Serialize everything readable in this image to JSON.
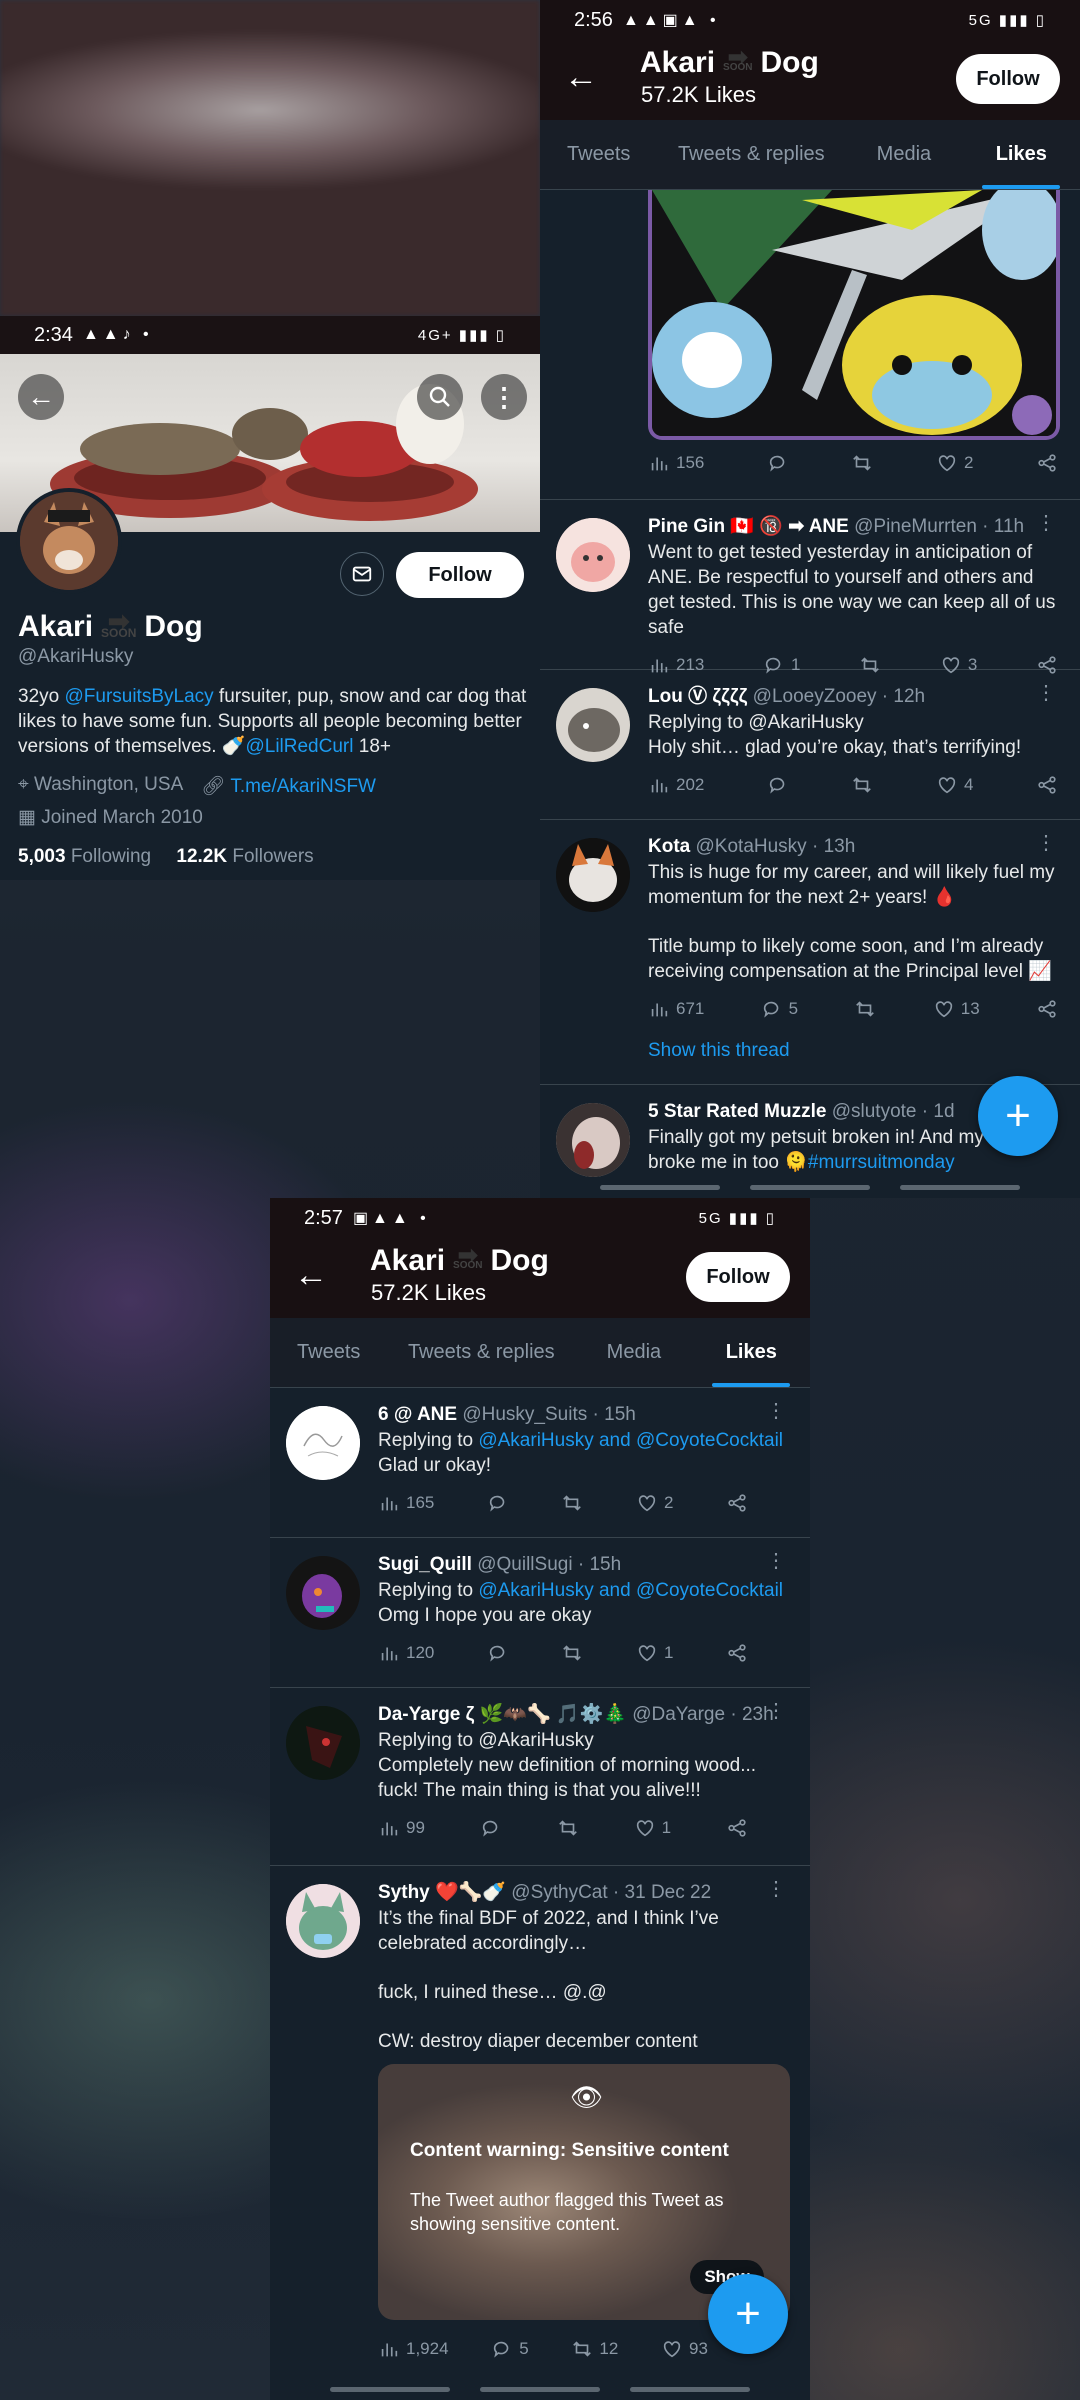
{
  "profile_panel": {
    "status": {
      "time": "2:34",
      "net": "4G+"
    },
    "name_a": "Akari",
    "name_b": "Dog",
    "arrow_text": "SOON",
    "handle": "@AkariHusky",
    "bio_1": "32yo ",
    "bio_link1": "@FursuitsByLacy",
    "bio_2": " fursuiter, pup, snow and car dog that likes to have some fun. Supports all people becoming better versions of themselves. 🍼",
    "bio_link2": "@LilRedCurl",
    "bio_3": " 18+",
    "location": "Washington, USA",
    "link": "T.me/AkariNSFW",
    "joined": "Joined March 2010",
    "following_count": "5,003",
    "following_label": "Following",
    "followers_count": "12.2K",
    "followers_label": "Followers",
    "follow_label": "Follow"
  },
  "likes_top": {
    "status": {
      "time": "2:56",
      "net": "5G"
    },
    "header": {
      "name_a": "Akari",
      "name_b": "Dog",
      "arrow_text": "SOON",
      "likes": "57.2K Likes",
      "follow_label": "Follow"
    },
    "tabs": [
      "Tweets",
      "Tweets & replies",
      "Media",
      "Likes"
    ],
    "image_actions": {
      "views": "156",
      "likes": "2"
    },
    "tweets": [
      {
        "name": "Pine Gin 🇨🇦 🔞 ➡ ANE",
        "handle": "@PineMurrten",
        "time": "11h",
        "text": "Went to get tested yesterday in anticipation of ANE. Be respectful to yourself and others and get tested. This is one way we can keep all of us safe",
        "views": "213",
        "replies": "1",
        "retweets": "",
        "likes": "3"
      },
      {
        "name": "Lou Ⓥ ζζζζ",
        "handle": "@LooeyZooey",
        "time": "12h",
        "reply_to": "Replying to @AkariHusky",
        "text": "Holy shit… glad you’re okay, that’s terrifying!",
        "views": "202",
        "replies": "",
        "retweets": "",
        "likes": "4"
      },
      {
        "name": "Kota",
        "handle": "@KotaHusky",
        "time": "13h",
        "text1": "This is huge for my career, and will likely fuel my momentum for the next 2+ years! 🩸",
        "text2": "Title bump to likely come soon, and I’m already receiving compensation at the Principal level 📈",
        "views": "671",
        "replies": "5",
        "retweets": "",
        "likes": "13",
        "thread": "Show this thread"
      },
      {
        "name": "5 Star Rated Muzzle",
        "handle": "@slutyote",
        "time": "1d",
        "text": "Finally got my petsuit broken in! And my",
        "text2": "broke me in too 🫠",
        "hashtag": "#murrsuitmonday"
      }
    ]
  },
  "likes_bottom": {
    "status": {
      "time": "2:57",
      "net": "5G"
    },
    "header": {
      "name_a": "Akari",
      "name_b": "Dog",
      "arrow_text": "SOON",
      "likes": "57.2K Likes",
      "follow_label": "Follow"
    },
    "tabs": [
      "Tweets",
      "Tweets & replies",
      "Media",
      "Likes"
    ],
    "tweets": [
      {
        "name": "6 @ ANE",
        "handle": "@Husky_Suits",
        "time": "15h",
        "reply_prefix": "Replying to ",
        "reply_links": "@AkariHusky and @CoyoteCocktail",
        "text": "Glad ur okay!",
        "views": "165",
        "replies": "",
        "retweets": "",
        "likes": "2"
      },
      {
        "name": "Sugi_Quill",
        "handle": "@QuillSugi",
        "time": "15h",
        "reply_prefix": "Replying to ",
        "reply_links": "@AkariHusky and @CoyoteCocktail",
        "text": "Omg I hope you are okay",
        "views": "120",
        "replies": "",
        "retweets": "",
        "likes": "1"
      },
      {
        "name": "Da-Yarge ζ 🌿🦇🦴 🎵⚙️🎄",
        "handle": "@DaYarge",
        "time": "23h",
        "reply_to": "Replying to @AkariHusky",
        "text": "Completely new definition of morning wood... fuck! The main thing is that you alive!!!",
        "views": "99",
        "replies": "",
        "retweets": "",
        "likes": "1"
      },
      {
        "name": "Sythy ❤️🦴🍼",
        "handle": "@SythyCat",
        "time": "31 Dec 22",
        "text1": "It’s the final BDF of 2022, and I think I’ve celebrated accordingly…",
        "text2": "fuck, I ruined these… @.@",
        "text3": "CW: destroy diaper december content",
        "cw_title": "Content warning: Sensitive content",
        "cw_body": "The Tweet author flagged this Tweet as showing sensitive content.",
        "cw_button": "Show",
        "views": "1,924",
        "replies": "5",
        "retweets": "12",
        "likes": "93"
      }
    ]
  }
}
